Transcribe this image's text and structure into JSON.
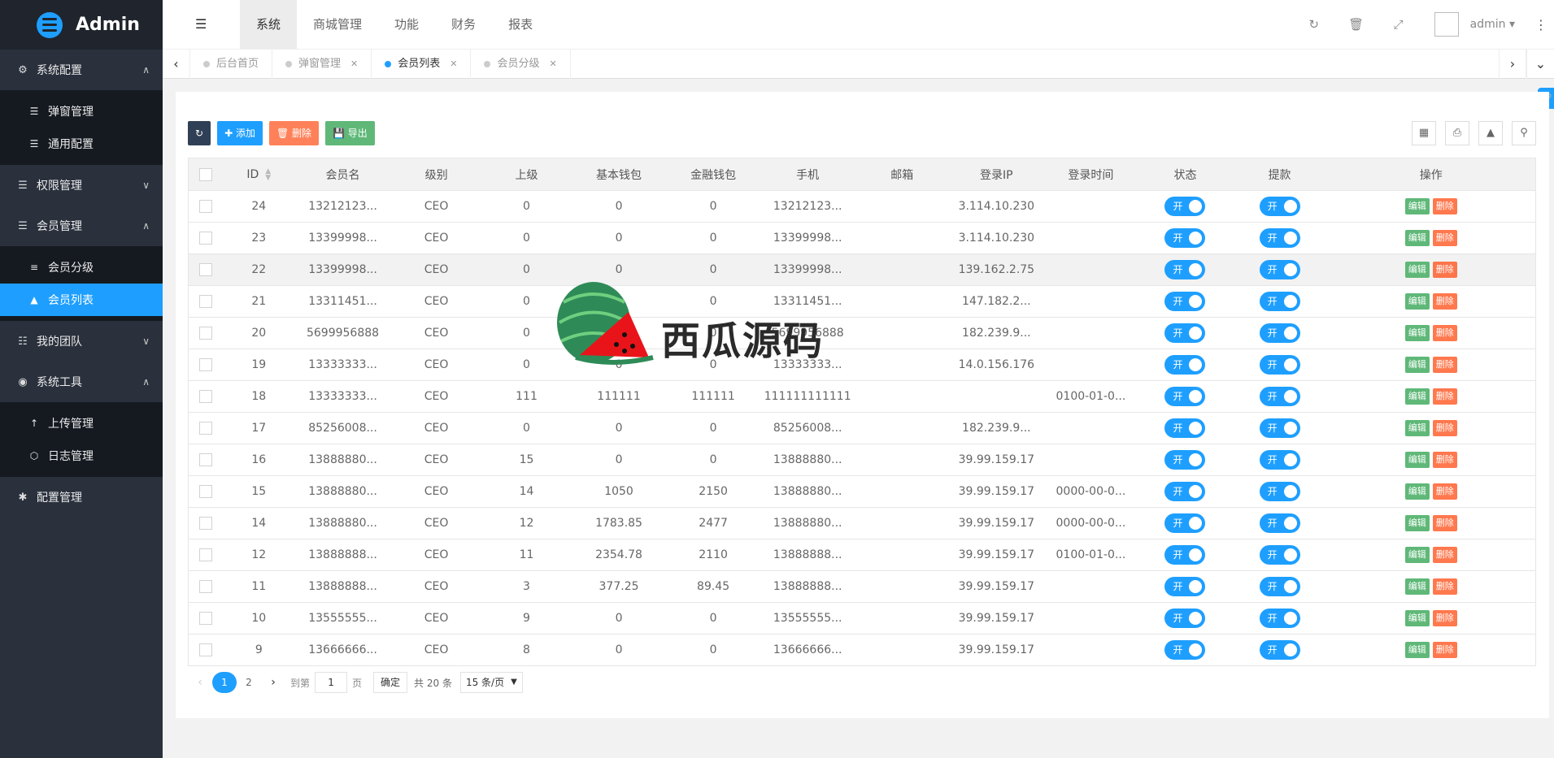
{
  "app": {
    "title": "Admin"
  },
  "sidebar": {
    "groups": [
      {
        "label": "系统配置",
        "icon": "gears-icon",
        "arrow": "︿",
        "sub": [
          {
            "label": "弹窗管理",
            "icon": "list-icon"
          },
          {
            "label": "通用配置",
            "icon": "list-icon"
          }
        ]
      },
      {
        "label": "权限管理",
        "icon": "list-icon",
        "arrow": "﹀"
      },
      {
        "label": "会员管理",
        "icon": "list-icon",
        "arrow": "︿",
        "sub": [
          {
            "label": "会员分级",
            "icon": "reorder-icon"
          },
          {
            "label": "会员列表",
            "icon": "graduation-cap-icon",
            "active": true
          }
        ]
      },
      {
        "label": "我的团队",
        "icon": "sitemap-icon",
        "arrow": "﹀"
      },
      {
        "label": "系统工具",
        "icon": "compass-icon",
        "arrow": "︿",
        "sub": [
          {
            "label": "上传管理",
            "icon": "arrow-up-icon"
          },
          {
            "label": "日志管理",
            "icon": "bug-icon"
          }
        ]
      },
      {
        "label": "配置管理",
        "icon": "asterisk-icon"
      }
    ]
  },
  "topnav": {
    "items": [
      "系统",
      "商城管理",
      "功能",
      "财务",
      "报表"
    ],
    "active": 0
  },
  "header": {
    "username": "admin"
  },
  "tabs": [
    {
      "label": "后台首页",
      "closable": false
    },
    {
      "label": "弹窗管理",
      "closable": true
    },
    {
      "label": "会员列表",
      "closable": true,
      "active": true
    },
    {
      "label": "会员分级",
      "closable": true
    }
  ],
  "toolbar": {
    "add": "添加",
    "delete": "删除",
    "export": "导出"
  },
  "table": {
    "headers": [
      "ID",
      "会员名",
      "级别",
      "上级",
      "基本钱包",
      "金融钱包",
      "手机",
      "邮箱",
      "登录IP",
      "登录时间",
      "状态",
      "提款",
      "操作"
    ],
    "switch_label": "开",
    "edit_label": "编辑",
    "delete_label": "删除",
    "rows": [
      [
        "24",
        "13212123...",
        "CEO",
        "0",
        "0",
        "0",
        "13212123...",
        "",
        "3.114.10.230",
        ""
      ],
      [
        "23",
        "13399998...",
        "CEO",
        "0",
        "0",
        "0",
        "13399998...",
        "",
        "3.114.10.230",
        ""
      ],
      [
        "22",
        "13399998...",
        "CEO",
        "0",
        "0",
        "0",
        "13399998...",
        "",
        "139.162.2.75",
        ""
      ],
      [
        "21",
        "13311451...",
        "CEO",
        "0",
        "0",
        "0",
        "13311451...",
        "",
        "147.182.2...",
        ""
      ],
      [
        "20",
        "5699956888",
        "CEO",
        "0",
        "0",
        "0",
        "5699956888",
        "",
        "182.239.9...",
        ""
      ],
      [
        "19",
        "13333333...",
        "CEO",
        "0",
        "0",
        "0",
        "13333333...",
        "",
        "14.0.156.176",
        ""
      ],
      [
        "18",
        "13333333...",
        "CEO",
        "111",
        "111111",
        "111111",
        "111111111111",
        "",
        "",
        "0100-01-0..."
      ],
      [
        "17",
        "85256008...",
        "CEO",
        "0",
        "0",
        "0",
        "85256008...",
        "",
        "182.239.9...",
        ""
      ],
      [
        "16",
        "13888880...",
        "CEO",
        "15",
        "0",
        "0",
        "13888880...",
        "",
        "39.99.159.17",
        ""
      ],
      [
        "15",
        "13888880...",
        "CEO",
        "14",
        "1050",
        "2150",
        "13888880...",
        "",
        "39.99.159.17",
        "0000-00-0..."
      ],
      [
        "14",
        "13888880...",
        "CEO",
        "12",
        "1783.85",
        "2477",
        "13888880...",
        "",
        "39.99.159.17",
        "0000-00-0..."
      ],
      [
        "12",
        "13888888...",
        "CEO",
        "11",
        "2354.78",
        "2110",
        "13888888...",
        "",
        "39.99.159.17",
        "0100-01-0..."
      ],
      [
        "11",
        "13888888...",
        "CEO",
        "3",
        "377.25",
        "89.45",
        "13888888...",
        "",
        "39.99.159.17",
        ""
      ],
      [
        "10",
        "13555555...",
        "CEO",
        "9",
        "0",
        "0",
        "13555555...",
        "",
        "39.99.159.17",
        ""
      ],
      [
        "9",
        "13666666...",
        "CEO",
        "8",
        "0",
        "0",
        "13666666...",
        "",
        "39.99.159.17",
        ""
      ]
    ]
  },
  "pager": {
    "pages": [
      "1",
      "2"
    ],
    "current": "1",
    "goto_label": "到第",
    "goto_value": "1",
    "page_unit": "页",
    "confirm": "确定",
    "total": "共 20 条",
    "per_page": "15 条/页"
  },
  "watermark": {
    "text": "西瓜源码"
  },
  "colors": {
    "sidebar": "#2a313d",
    "accent": "#1e9fff",
    "edit": "#5fb878",
    "delete": "#ff5722"
  }
}
